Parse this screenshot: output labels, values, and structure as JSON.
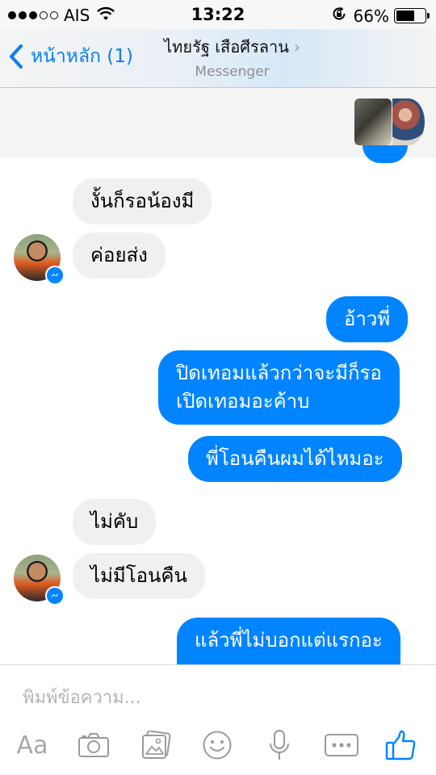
{
  "status_bar": {
    "carrier": "AIS",
    "time": "13:22",
    "battery_percent": "66%",
    "battery_level": 0.66,
    "signal_bars_filled": 3,
    "signal_bars_total": 5
  },
  "nav": {
    "back_label": "หน้าหลัก (1)",
    "contact_name": "ไทยรัฐ เสือศีรลาน",
    "chevron": "›",
    "subtitle": "Messenger"
  },
  "messages": [
    {
      "direction": "in",
      "text": "งั้นก็รอน้องมี"
    },
    {
      "direction": "in",
      "text": "ค่อยส่ง"
    },
    {
      "direction": "out",
      "text": "อ้าวพี่"
    },
    {
      "direction": "out",
      "text_line1": "ปิดเทอมแล้วกว่าจะมีก็รอ",
      "text_line2": "เปิดเทอมอะค้าบ"
    },
    {
      "direction": "out",
      "text": "พี่โอนคืนผมได้ไหมอะ"
    },
    {
      "direction": "in",
      "text": "ไม่คับ"
    },
    {
      "direction": "in",
      "text": "ไม่มีโอนคืน"
    },
    {
      "direction": "out",
      "text": "แล้วพี่ไม่บอกแต่แรกอะ"
    }
  ],
  "composer": {
    "placeholder": "พิมพ์ข้อความ...",
    "aa_label": "Aa"
  },
  "icons": {
    "text_format": "aa-icon",
    "camera": "camera-icon",
    "gallery": "gallery-icon",
    "emoji": "emoji-icon",
    "mic": "microphone-icon",
    "more": "more-icon",
    "like": "thumbs-up-icon"
  },
  "colors": {
    "accent": "#0084ff",
    "incoming_bubble": "#f1f0f0",
    "link_blue": "#0b7ef3",
    "icon_gray": "#9a9a9a"
  }
}
